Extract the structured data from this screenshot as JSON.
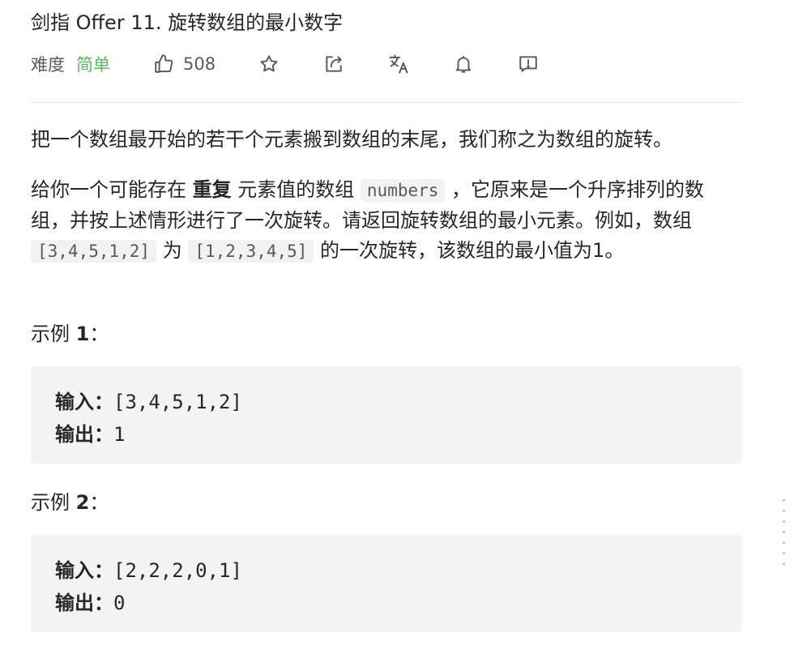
{
  "problem": {
    "title": "剑指 Offer 11. 旋转数组的最小数字",
    "difficulty_label": "难度",
    "difficulty_value": "简单",
    "likes": "508"
  },
  "toolbar": {
    "icons": [
      "thumbs-up-icon",
      "star-icon",
      "share-icon",
      "translate-icon",
      "bell-icon",
      "feedback-icon"
    ]
  },
  "description": {
    "p1": "把一个数组最开始的若干个元素搬到数组的末尾，我们称之为数组的旋转。",
    "p2_a": "给你一个可能存在 ",
    "p2_bold": "重复",
    "p2_b": " 元素值的数组 ",
    "p2_code1": "numbers",
    "p2_c": " ，它原来是一个升序排列的数组，并按上述情形进行了一次旋转。请返回旋转数组的最小元素。例如，数组 ",
    "p2_code2": "[3,4,5,1,2]",
    "p2_d": " 为 ",
    "p2_code3": "[1,2,3,4,5]",
    "p2_e": " 的一次旋转，该数组的最小值为1。"
  },
  "examples": [
    {
      "title_prefix": "示例 ",
      "title_num": "1",
      "title_suffix": "：",
      "input_label": "输入：",
      "input_value": "[3,4,5,1,2]",
      "output_label": "输出：",
      "output_value": "1"
    },
    {
      "title_prefix": "示例 ",
      "title_num": "2",
      "title_suffix": "：",
      "input_label": "输入：",
      "input_value": "[2,2,2,0,1]",
      "output_label": "输出：",
      "output_value": "0"
    }
  ],
  "colors": {
    "difficulty_easy": "#5cb85c",
    "text": "#262626",
    "muted": "#595959",
    "code_bg": "#f3f3f3"
  }
}
